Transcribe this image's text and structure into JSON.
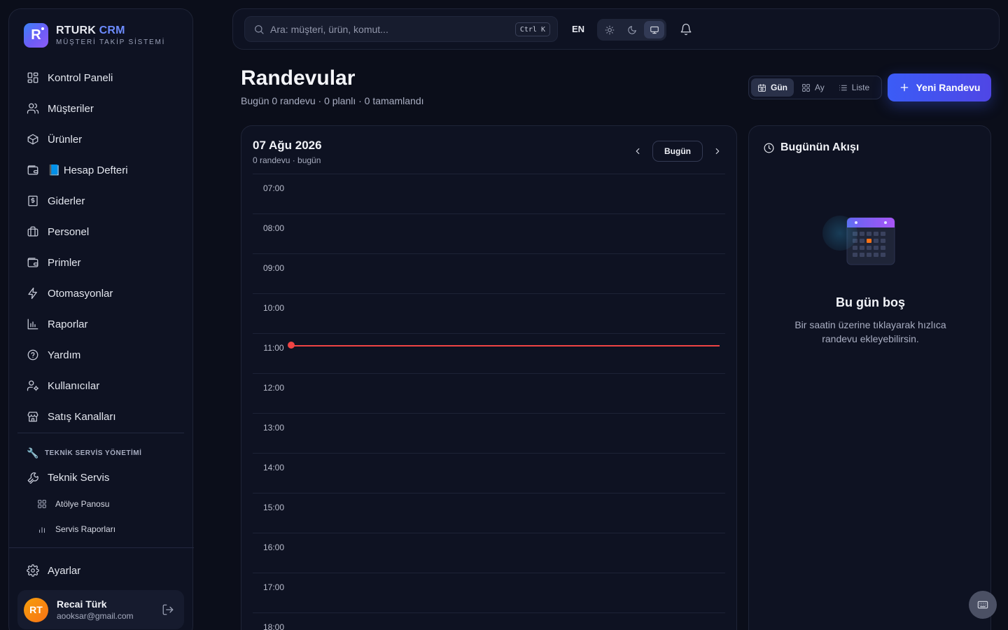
{
  "brand": {
    "logo_letter": "R",
    "name_primary": "RTURK",
    "name_accent": "CRM",
    "subtitle": "MÜŞTERİ TAKİP SİSTEMİ"
  },
  "sidebar": {
    "items": [
      {
        "label": "Kontrol Paneli",
        "icon": "dashboard-icon"
      },
      {
        "label": "Müşteriler",
        "icon": "users-icon"
      },
      {
        "label": "Ürünler",
        "icon": "package-icon"
      },
      {
        "label": "📘 Hesap Defteri",
        "icon": "wallet-icon"
      },
      {
        "label": "Giderler",
        "icon": "receipt-icon"
      },
      {
        "label": "Personel",
        "icon": "briefcase-icon"
      },
      {
        "label": "Primler",
        "icon": "wallet-icon"
      },
      {
        "label": "Otomasyonlar",
        "icon": "zap-icon"
      },
      {
        "label": "Raporlar",
        "icon": "bar-chart-icon"
      },
      {
        "label": "Yardım",
        "icon": "help-icon"
      },
      {
        "label": "Kullanıcılar",
        "icon": "user-cog-icon"
      },
      {
        "label": "Satış Kanalları",
        "icon": "store-icon"
      }
    ],
    "section_title": "TEKNİK SERVİS YÖNETİMİ",
    "service_item": "Teknik Servis",
    "sub_items": [
      "Atölye Panosu",
      "Servis Raporları"
    ],
    "settings": "Ayarlar"
  },
  "user": {
    "initials": "RT",
    "name": "Recai Türk",
    "email": "aooksar@gmail.com"
  },
  "topbar": {
    "search_placeholder": "Ara: müşteri, ürün, komut...",
    "shortcut": "Ctrl K",
    "language": "EN"
  },
  "page": {
    "title": "Randevular",
    "subtitle": "Bugün 0 randevu · 0 planlı · 0 tamamlandı",
    "views": [
      "Gün",
      "Ay",
      "Liste"
    ],
    "active_view": "Gün",
    "new_button": "Yeni Randevu"
  },
  "calendar": {
    "date": "07 Ağu 2026",
    "sub": "0 randevu · bugün",
    "today_button": "Bugün",
    "hours": [
      "07:00",
      "08:00",
      "09:00",
      "10:00",
      "11:00",
      "12:00",
      "13:00",
      "14:00",
      "15:00",
      "16:00",
      "17:00",
      "18:00"
    ]
  },
  "flow": {
    "title": "Bugünün Akışı",
    "empty_title": "Bu gün boş",
    "empty_desc": "Bir saatin üzerine tıklayarak hızlıca randevu ekleyebilirsin."
  },
  "colors": {
    "accent": "#3b5cf6",
    "now_line": "#ef4444",
    "avatar": "#f59e0b"
  }
}
